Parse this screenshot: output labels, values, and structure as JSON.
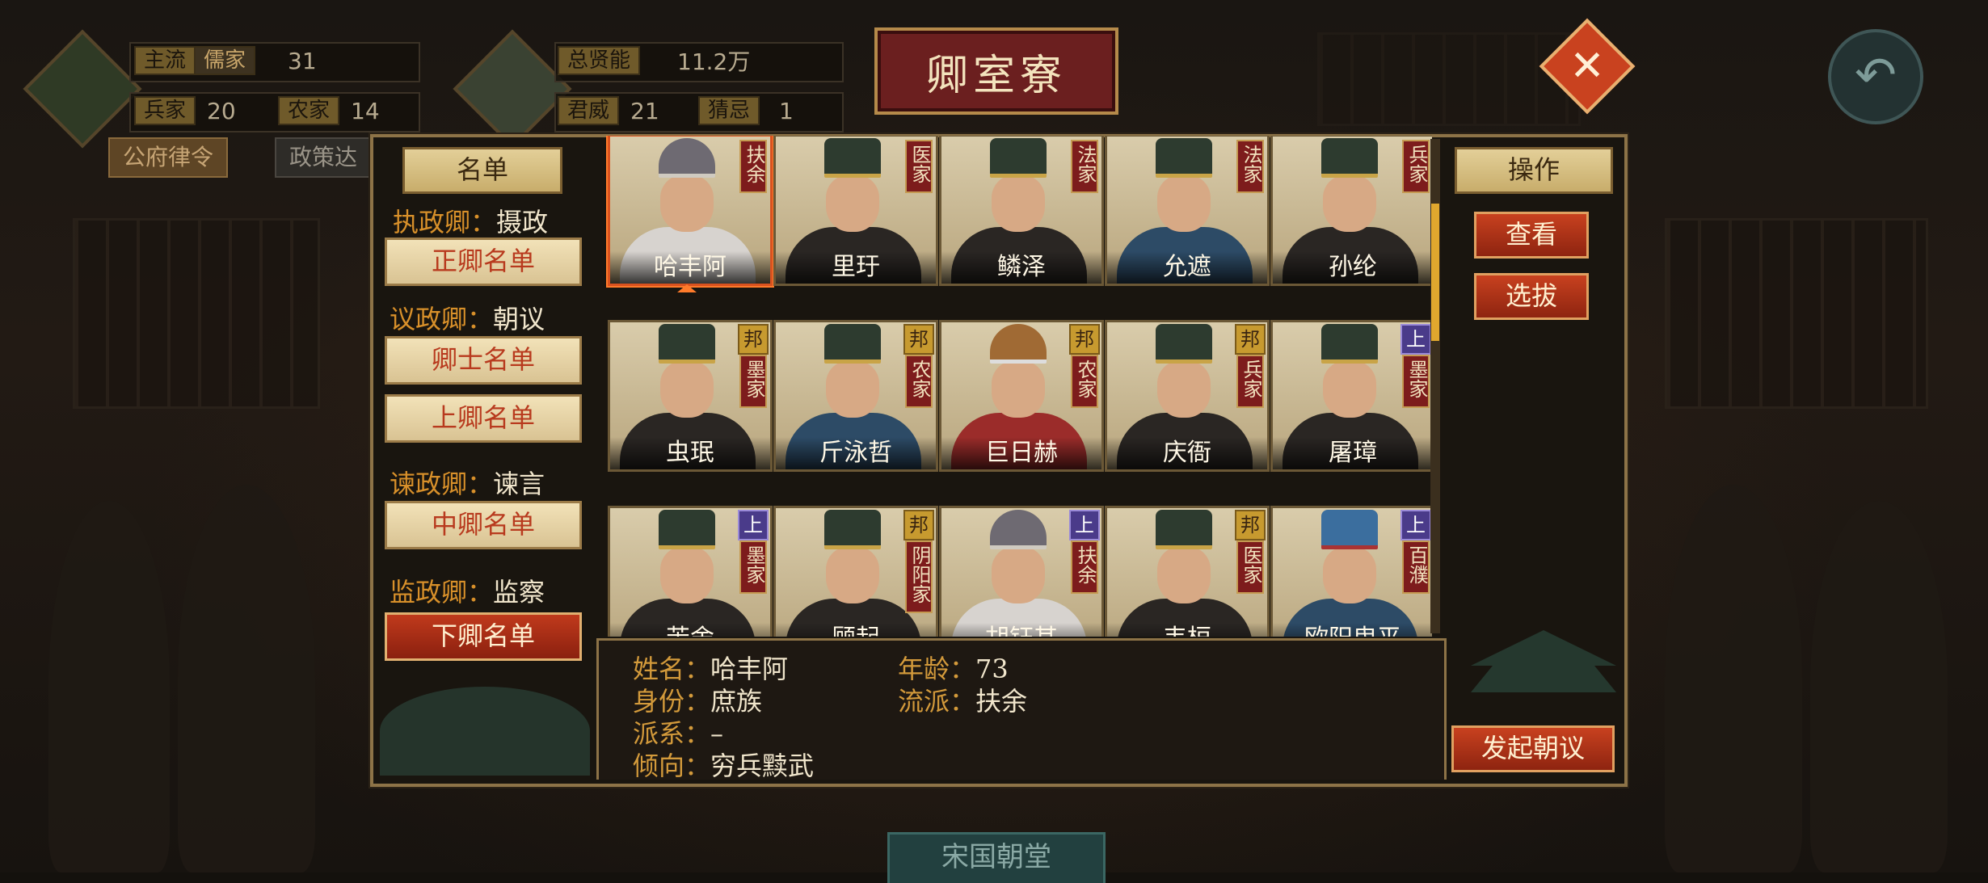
{
  "top_stats": {
    "main_label": "主流",
    "main_school": "儒家",
    "main_value": "31",
    "bing_label": "兵家",
    "bing_value": "20",
    "nong_label": "农家",
    "nong_value": "14",
    "total_label": "总贤能",
    "total_value": "11.2万",
    "junwei_label": "君威",
    "junwei_value": "21",
    "jiji_label": "猜忌",
    "jiji_value": "1",
    "btn_gongfu": "公府律令",
    "btn_zhengce": "政策达"
  },
  "title": "卿室寮",
  "close_icon": "close-icon",
  "back_icon": "back-arrow-icon",
  "left": {
    "header": "名单",
    "roles": [
      {
        "label": "执政卿：",
        "value": "摄政"
      },
      {
        "label": "议政卿：",
        "value": "朝议"
      },
      {
        "label": "谏政卿：",
        "value": "谏言"
      },
      {
        "label": "监政卿：",
        "value": "监察"
      }
    ],
    "buttons": [
      "正卿名单",
      "卿士名单",
      "上卿名单",
      "中卿名单",
      "下卿名单"
    ]
  },
  "cards": [
    {
      "name": "哈丰阿",
      "school": "扶余",
      "badge": ""
    },
    {
      "name": "里玗",
      "school": "医家",
      "badge": ""
    },
    {
      "name": "鳞泽",
      "school": "法家",
      "badge": ""
    },
    {
      "name": "允遮",
      "school": "法家",
      "badge": ""
    },
    {
      "name": "孙纶",
      "school": "兵家",
      "badge": ""
    },
    {
      "name": "虫珉",
      "school": "墨家",
      "badge": "邦"
    },
    {
      "name": "斤泳哲",
      "school": "农家",
      "badge": "邦"
    },
    {
      "name": "巨日赫",
      "school": "农家",
      "badge": "邦"
    },
    {
      "name": "庆衙",
      "school": "兵家",
      "badge": "邦"
    },
    {
      "name": "屠璋",
      "school": "墨家",
      "badge": "上"
    },
    {
      "name": "苦舍",
      "school": "墨家",
      "badge": "上"
    },
    {
      "name": "顾起",
      "school": "阴阳家",
      "badge": "邦"
    },
    {
      "name": "胡钰其",
      "school": "扶余",
      "badge": "上"
    },
    {
      "name": "韦桓",
      "school": "医家",
      "badge": "邦"
    },
    {
      "name": "欧阳曳平",
      "school": "百濮",
      "badge": "上"
    }
  ],
  "info": {
    "name_label": "姓名：",
    "name_value": "哈丰阿",
    "age_label": "年龄：",
    "age_value": "73",
    "status_label": "身份：",
    "status_value": "庶族",
    "school_label": "流派：",
    "school_value": "扶余",
    "faction_label": "派系：",
    "faction_value": "–",
    "tendency_label": "倾向：",
    "tendency_value": "穷兵黩武"
  },
  "right": {
    "header": "操作",
    "view": "查看",
    "select": "选拔",
    "start_court": "发起朝议"
  },
  "bottom_tab": "宋国朝堂"
}
